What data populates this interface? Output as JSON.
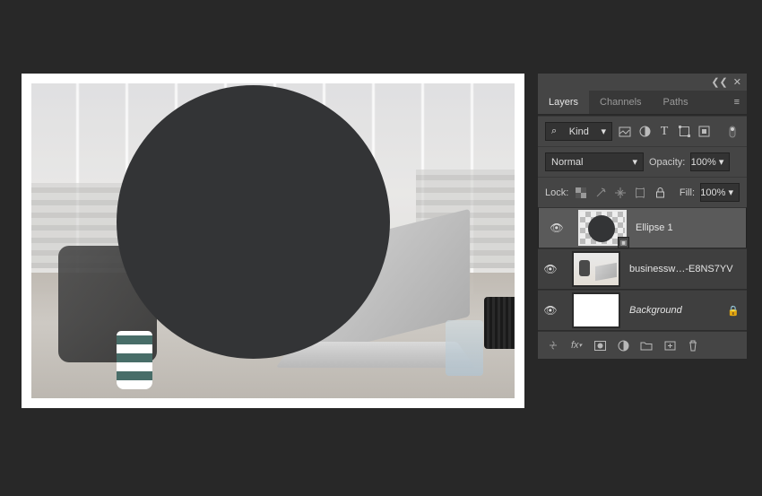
{
  "panel": {
    "tabs": [
      "Layers",
      "Channels",
      "Paths"
    ],
    "activeTab": 0,
    "filter": {
      "label": "Kind",
      "search": "⌕"
    },
    "typeIcons": [
      "image",
      "adjust",
      "type",
      "shape",
      "smart"
    ],
    "blend": {
      "mode": "Normal",
      "opacityLabel": "Opacity:",
      "opacityValue": "100%",
      "fillLabel": "Fill:",
      "fillValue": "100%"
    },
    "lock": {
      "label": "Lock:"
    },
    "layers": [
      {
        "name": "Ellipse 1",
        "type": "shape",
        "selected": true,
        "visible": true
      },
      {
        "name": "businessw…-E8NS7YV",
        "type": "image",
        "selected": false,
        "visible": true
      },
      {
        "name": "Background",
        "type": "bg",
        "selected": false,
        "visible": true,
        "locked": true
      }
    ],
    "collapse": {
      "left": "❮❮",
      "close": "✕"
    }
  }
}
